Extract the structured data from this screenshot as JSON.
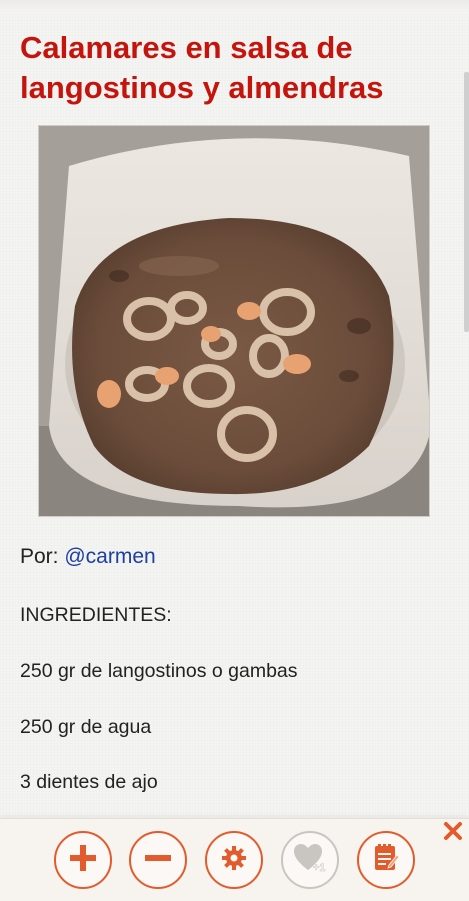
{
  "recipe": {
    "title": "Calamares en salsa de langostinos y almendras",
    "author_prefix": "Por: ",
    "author_handle": "@carmen",
    "lines": [
      "INGREDIENTES:",
      "250 gr de langostinos o gambas",
      "250 gr de agua",
      "3 dientes de ajo"
    ]
  },
  "toolbar": {
    "buttons": [
      {
        "name": "zoom-in-button",
        "icon": "plus-icon"
      },
      {
        "name": "zoom-out-button",
        "icon": "minus-icon"
      },
      {
        "name": "settings-button",
        "icon": "gear-icon"
      },
      {
        "name": "favorite-button",
        "icon": "heart-plus-one-icon",
        "badge": "+1",
        "enabled": false
      },
      {
        "name": "notes-button",
        "icon": "notepad-icon"
      }
    ],
    "close_icon": "close-icon"
  },
  "colors": {
    "title": "#c4140c",
    "link": "#1d3fa0",
    "accent": "#e35b2c",
    "disabled": "#c9c6c2"
  }
}
